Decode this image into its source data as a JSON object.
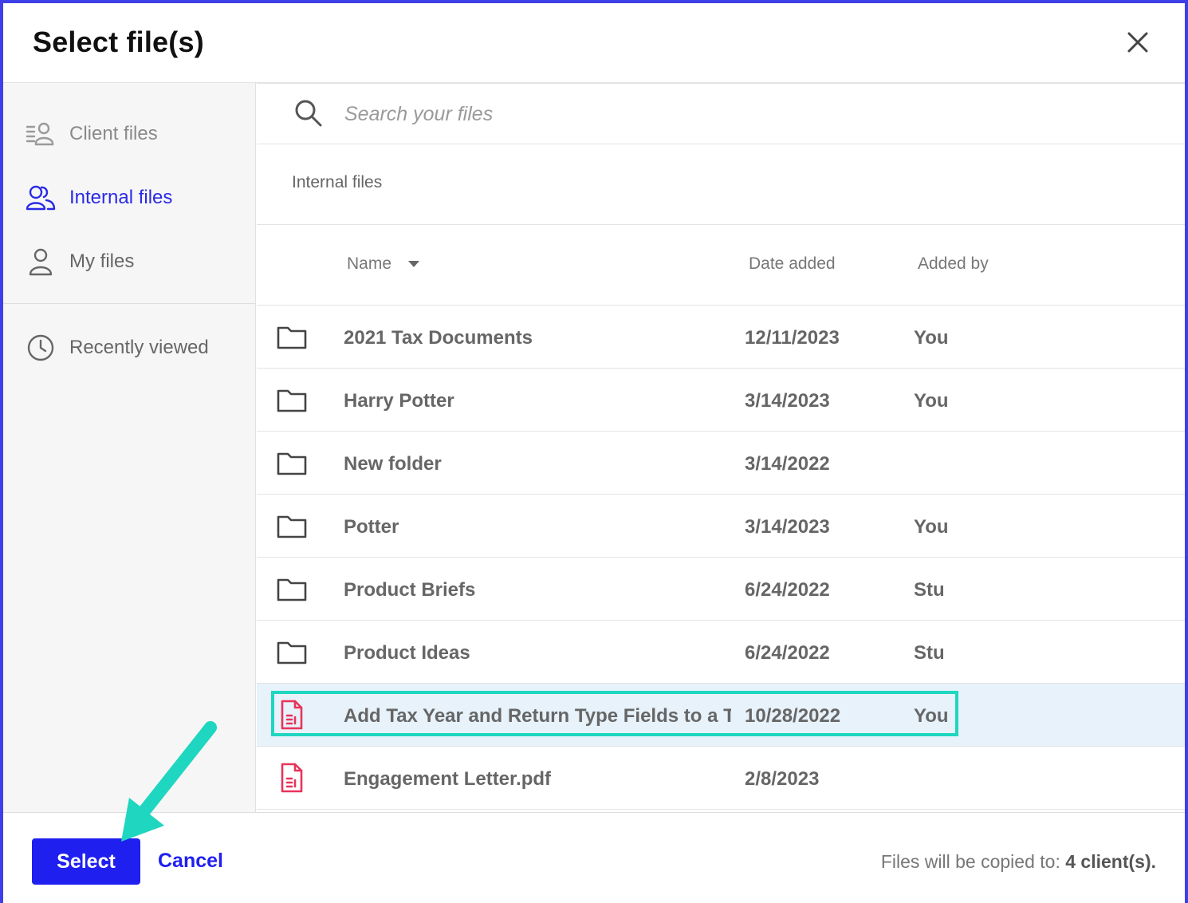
{
  "dialog": {
    "title": "Select file(s)"
  },
  "sidebar": {
    "items": [
      {
        "label": "Client files",
        "icon": "client-files-icon"
      },
      {
        "label": "Internal files",
        "icon": "users-icon",
        "active": true
      },
      {
        "label": "My files",
        "icon": "user-icon"
      },
      {
        "label": "Recently viewed",
        "icon": "clock-icon"
      }
    ]
  },
  "search": {
    "placeholder": "Search your files"
  },
  "breadcrumb": "Internal files",
  "columns": {
    "name": "Name",
    "date": "Date added",
    "added_by": "Added by"
  },
  "rows": [
    {
      "type": "folder",
      "name": "2021 Tax Documents",
      "date": "12/11/2023",
      "by": "You"
    },
    {
      "type": "folder",
      "name": "Harry Potter",
      "date": "3/14/2023",
      "by": "You"
    },
    {
      "type": "folder",
      "name": "New folder",
      "date": "3/14/2022",
      "by": ""
    },
    {
      "type": "folder",
      "name": "Potter",
      "date": "3/14/2023",
      "by": "You"
    },
    {
      "type": "folder",
      "name": "Product Briefs",
      "date": "6/24/2022",
      "by": "Stu"
    },
    {
      "type": "folder",
      "name": "Product Ideas",
      "date": "6/24/2022",
      "by": "Stu"
    },
    {
      "type": "file",
      "name": "Add Tax Year and Return Type Fields to a T",
      "date": "10/28/2022",
      "by": "You",
      "selected": true
    },
    {
      "type": "file",
      "name": "Engagement Letter.pdf",
      "date": "2/8/2023",
      "by": ""
    }
  ],
  "footer": {
    "select_label": "Select",
    "cancel_label": "Cancel",
    "note_prefix": "Files will be copied to:",
    "note_value": "4 client(s)."
  },
  "colors": {
    "accent": "#1f1ff0",
    "highlight": "#1fd6c0",
    "file_icon": "#e8345a",
    "selected_row": "#e7f2fb"
  }
}
